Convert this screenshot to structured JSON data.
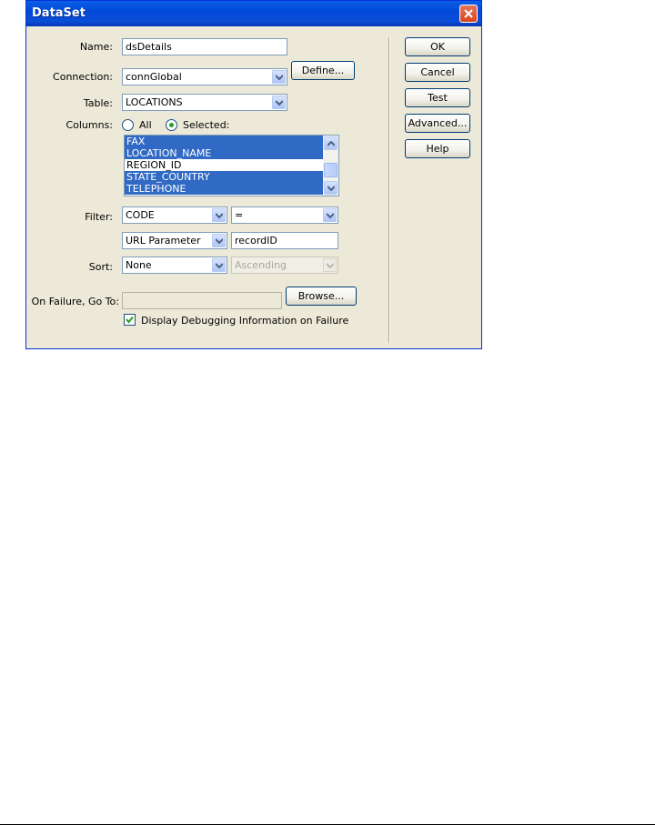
{
  "window": {
    "title": "DataSet"
  },
  "form": {
    "name_label": "Name:",
    "name_value": "dsDetails",
    "connection_label": "Connection:",
    "connection_value": "connGlobal",
    "define_button": "Define...",
    "table_label": "Table:",
    "table_value": "LOCATIONS",
    "columns_label": "Columns:",
    "columns_all": "All",
    "columns_selected": "Selected:",
    "column_items": [
      {
        "label": "FAX",
        "selected": true
      },
      {
        "label": "LOCATION_NAME",
        "selected": true
      },
      {
        "label": "REGION_ID",
        "selected": false
      },
      {
        "label": "STATE_COUNTRY",
        "selected": true
      },
      {
        "label": "TELEPHONE",
        "selected": true
      }
    ],
    "filter_label": "Filter:",
    "filter_column": "CODE",
    "filter_operator": "=",
    "filter_source": "URL Parameter",
    "filter_value": "recordID",
    "sort_label": "Sort:",
    "sort_column": "None",
    "sort_order": "Ascending",
    "failure_label": "On Failure, Go To:",
    "failure_value": "",
    "browse_button": "Browse...",
    "debug_label": "Display Debugging Information on Failure",
    "debug_checked": true
  },
  "side_buttons": {
    "ok": "OK",
    "cancel": "Cancel",
    "test": "Test",
    "advanced": "Advanced...",
    "help": "Help"
  },
  "colors": {
    "title_bar": "#0148d8",
    "selection": "#316ac5",
    "dialog_bg": "#ece9d8"
  }
}
